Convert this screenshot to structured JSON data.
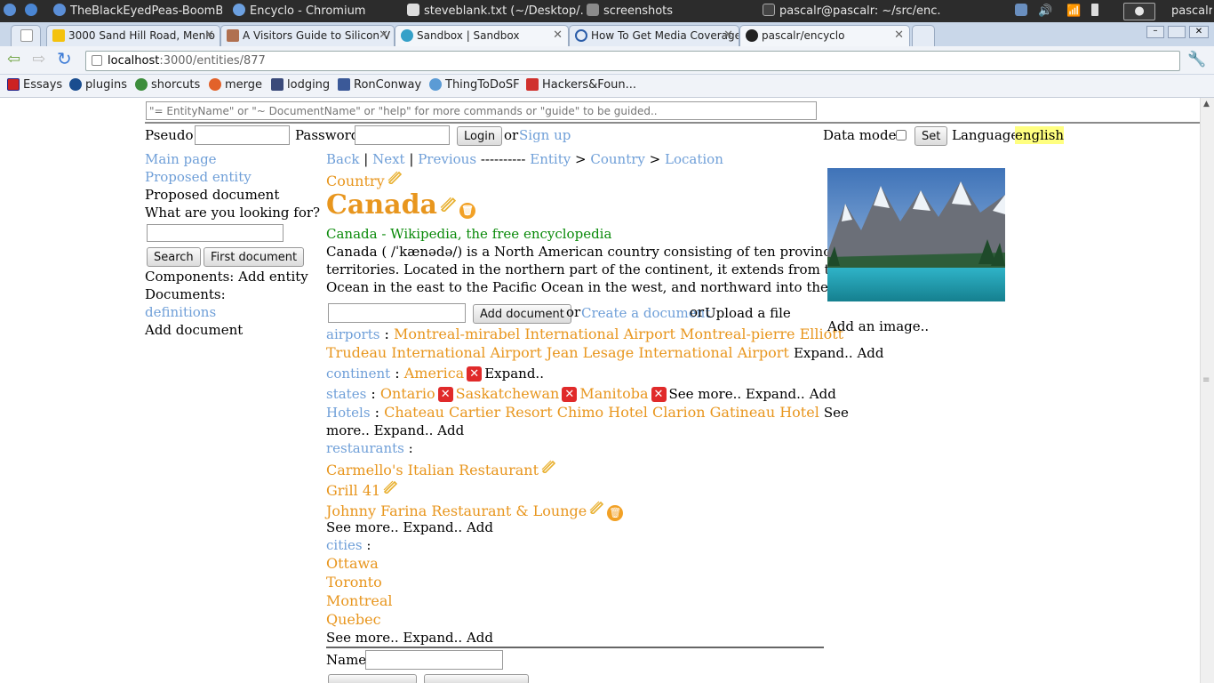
{
  "os_bar": {
    "items": [
      "TheBlackEyedPeas-BoomB...",
      "Encyclo - Chromium",
      "steveblank.txt (~/Desktop/...",
      "screenshots",
      "pascalr@pascalr: ~/src/enc..."
    ],
    "user": "pascalr"
  },
  "tabs": [
    {
      "label": "3000 Sand Hill Road, Menlo",
      "favicon": "maps-pin-icon"
    },
    {
      "label": "A Visitors Guide to Silicon V",
      "favicon": "photo-icon"
    },
    {
      "label": "Sandbox | Sandbox",
      "favicon": "gear-icon"
    },
    {
      "label": "How To Get Media Coverage",
      "favicon": "power-icon"
    },
    {
      "label": "pascalr/encyclo",
      "favicon": "github-icon"
    }
  ],
  "address": {
    "host": "localhost",
    "path": ":3000/entities/877"
  },
  "bookmarks": [
    "Essays",
    "plugins",
    "shorcuts",
    "merge",
    "lodging",
    "RonConway",
    "ThingToDoSF",
    "Hackers&Foun..."
  ],
  "command_bar": {
    "placeholder": "\"= EntityName\" or \"~ DocumentName\" or \"help\" for more commands or \"guide\" to be guided.."
  },
  "login": {
    "pseudo_label": "Pseudo:",
    "password_label": "Password",
    "login_button": "Login",
    "or": "or",
    "signup": "Sign up"
  },
  "settings": {
    "data_mode_label": "Data mode:",
    "set_button": "Set",
    "language_label": "Language:",
    "language_value": "english"
  },
  "sidebar": {
    "main_page": "Main page",
    "proposed_entity": "Proposed entity",
    "proposed_document": "Proposed document",
    "looking_for": "What are you looking for?",
    "search_button": "Search",
    "first_document_button": "First document",
    "components": "Components: Add entity",
    "documents": "Documents:",
    "definitions": "definitions",
    "add_document": "Add document"
  },
  "nav": {
    "back": "Back",
    "next": "Next",
    "previous": "Previous",
    "dashes": "----------",
    "crumb1": "Entity",
    "crumb2": "Country",
    "crumb3": "Location",
    "sep": ">",
    "bar": "|"
  },
  "entity": {
    "type": "Country",
    "name": "Canada",
    "wiki_title": "Canada - Wikipedia, the free encyclopedia",
    "summary_lines": [
      "Canada ( /ˈkænədə/) is a North American country consisting of ten provinces and three",
      "territories. Located in the northern part of the continent, it extends from the Atlantic",
      "Ocean in the east to the Pacific Ocean in the west, and northward into the ..."
    ]
  },
  "doc_actions": {
    "add_document": "Add document",
    "or1": "or",
    "create": "Create a document",
    "or2": "or",
    "upload": "Upload a file"
  },
  "relations": {
    "airports_label": "airports",
    "airports_line1": "Montreal-mirabel International Airport Montreal-pierre Elliott",
    "airports_line2": "Trudeau International Airport Jean Lesage International Airport",
    "continent_label": "continent",
    "continent_value": "America",
    "states_label": "states",
    "states": [
      "Ontario",
      "Saskatchewan",
      "Manitoba"
    ],
    "hotels_label": "Hotels",
    "hotels": "Chateau Cartier Resort Chimo Hotel Clarion Gatineau Hotel",
    "restaurants_label": "restaurants",
    "restaurants": [
      "Carmello's Italian Restaurant",
      "Grill 41",
      "Johnny Farina Restaurant & Lounge"
    ],
    "cities_label": "cities",
    "cities": [
      "Ottawa",
      "Toronto",
      "Montreal",
      "Quebec"
    ],
    "colon": ":",
    "expand": "Expand..",
    "add": "Add",
    "see_more": "See more..",
    "see": "See",
    "more_expand": "more..  Expand..",
    "see_more_expand": "See more..  Expand..",
    "expand_add": "Expand..  Add"
  },
  "name_field": {
    "label": "Name"
  },
  "image_panel": {
    "add_image": "Add an image.."
  }
}
